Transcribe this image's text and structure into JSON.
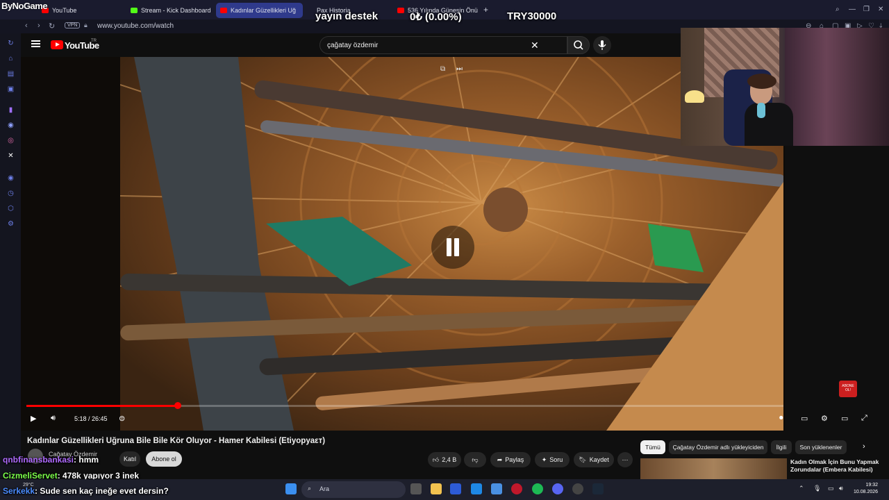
{
  "browser": {
    "brand": "ByNoGame",
    "tabs": [
      {
        "label": "YouTube",
        "color": "#ff0000"
      },
      {
        "label": "Stream - Kick Dashboard",
        "color": "#53fc18"
      },
      {
        "label": "Kadınlar Güzellikleri Uğ",
        "color": "#ff0000"
      },
      {
        "label": "Pax Historia",
        "color": "#888888"
      },
      {
        "label": "536 Yılında Güneşin Önünü",
        "color": "#ff0000"
      }
    ],
    "new_tab": "+",
    "url": "www.youtube.com/watch",
    "vpn": "VPN"
  },
  "overlay": {
    "support": "yayın destek",
    "percent": "0₺ (0.00%)",
    "goal": "TRY30000"
  },
  "youtube": {
    "logo_text": "YouTube",
    "region": "TR",
    "search_value": "çağatay özdemir"
  },
  "player": {
    "time": "5:18 / 26:45",
    "progress_fraction": 0.2,
    "abone": "ABONE OL!"
  },
  "video": {
    "title": "Kadınlar Güzellikleri Uğruna Bile Bile Kör Oluyor - Hamer Kabilesi (Etiyopyaεт)",
    "channel": "Cağatay Özdemir",
    "join": "Katıl",
    "subscribe": "Abone ol",
    "likes": "2,4 B",
    "share": "Paylaş",
    "ask": "Soru",
    "save": "Kaydet"
  },
  "chips": [
    "Tümü",
    "Çağatay Özdemir adlı yükleyiciden",
    "İlgili",
    "Son yüklenenler"
  ],
  "recommendation": {
    "title": "Kadın Olmak İçin Bunu Yapmak Zorundalar (Embera Kabilesi)"
  },
  "chat": [
    {
      "user": "qnbfinansbankasi",
      "message": ": hmm",
      "color": "#b06bff"
    },
    {
      "user": "CizmeliServet",
      "message": ": 478k yapıyor 3 inek",
      "color": "#7cff4a"
    },
    {
      "user": "Serkekk",
      "message": ": Sude sen kaç ineğe evet dersin?",
      "color": "#4a8cff"
    }
  ],
  "taskbar": {
    "search": "Ara",
    "weather": "29°C",
    "time": "19:32",
    "date": "10.08.2026"
  }
}
